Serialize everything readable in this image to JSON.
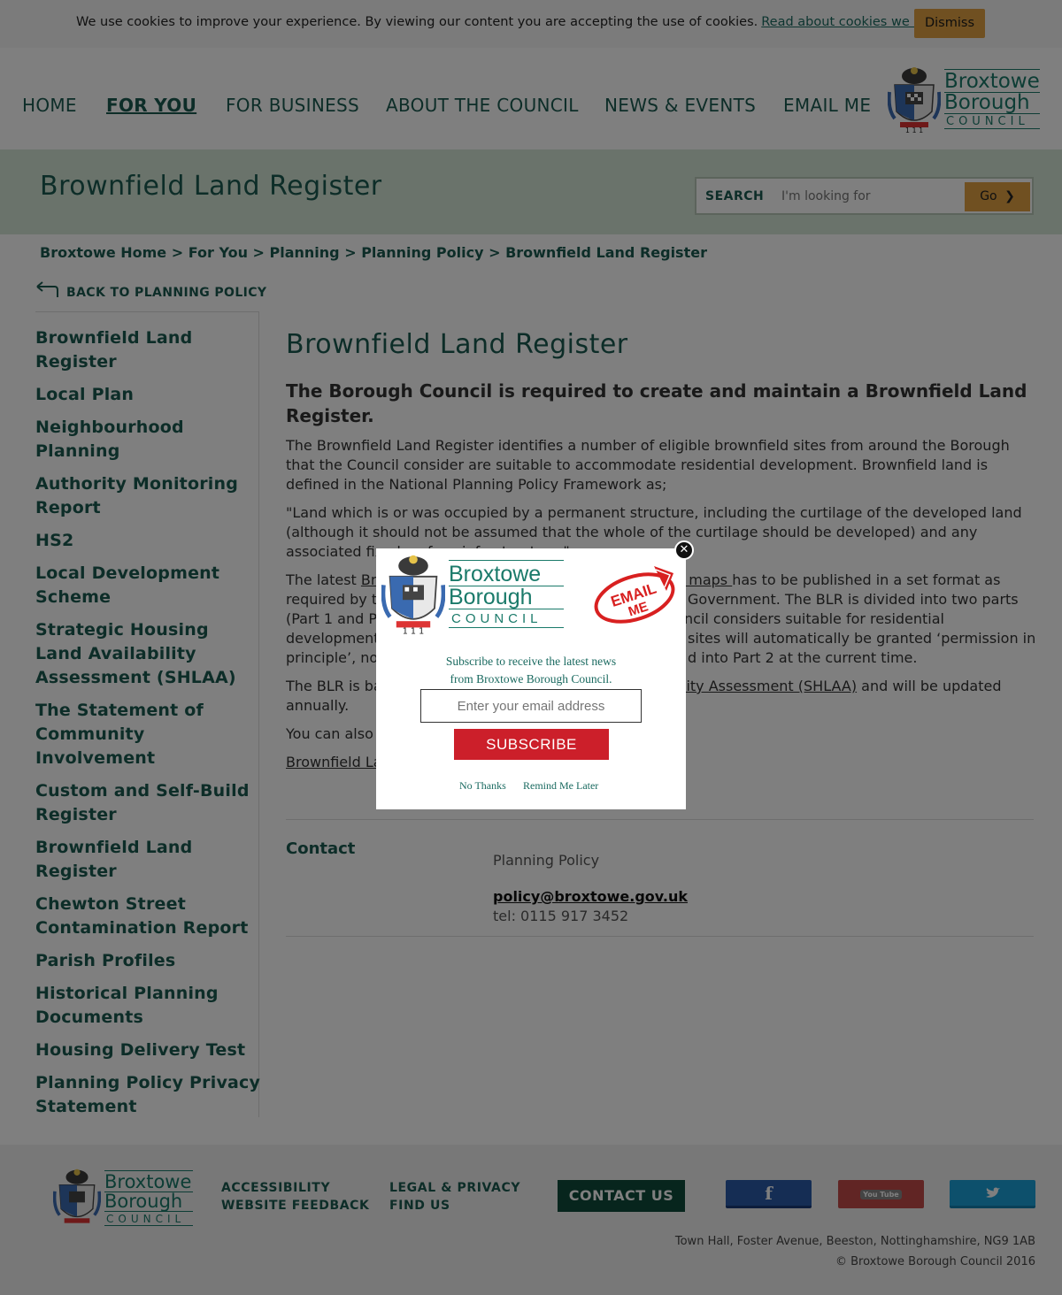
{
  "cookie": {
    "text": "We use cookies to improve your experience. By viewing our content you are accepting the use of cookies.",
    "link": "Read about cookies we use.",
    "dismiss": "Dismiss"
  },
  "nav": {
    "items": [
      "HOME",
      "FOR YOU",
      "FOR BUSINESS",
      "ABOUT THE COUNCIL",
      "NEWS & EVENTS",
      "EMAIL ME"
    ],
    "active": "FOR YOU"
  },
  "logo": {
    "line1": "Broxtowe",
    "line2": "Borough",
    "line3": "COUNCIL"
  },
  "banner": {
    "title": "Brownfield Land Register",
    "search_label": "SEARCH",
    "search_placeholder": "I'm looking for",
    "search_button": "Go"
  },
  "breadcrumb": [
    "Broxtowe Home",
    "For You",
    "Planning",
    "Planning Policy",
    "Brownfield Land Register"
  ],
  "back_label": "BACK TO PLANNING POLICY",
  "sidebar": {
    "items": [
      "Brownfield Land Register",
      "Local Plan",
      "Neighbourhood Planning",
      "Authority Monitoring Report",
      "HS2",
      "Local Development Scheme",
      "Strategic Housing Land Availability Assessment (SHLAA)",
      "The Statement of Community Involvement",
      "Custom and Self-Build Register",
      "Brownfield Land Register",
      "Chewton Street Contamination Report",
      "Parish Profiles",
      "Historical Planning Documents",
      "Housing Delivery Test",
      "Planning Policy Privacy Statement"
    ]
  },
  "main": {
    "title": "Brownfield Land Register",
    "lead": "The Borough Council is required to create and maintain a Brownfield Land Register.",
    "p1": "The Brownfield Land Register identifies a number of eligible brownfield sites from around the Borough that the Council consider are suitable to accommodate residential development. Brownfield land is defined in the National Planning Policy Framework as;",
    "p2": "\"Land which is or was occupied by a permanent structure, including the curtilage of the developed land (although it should not be assumed that the whole of the curtilage should be developed) and any associated fixed surface infrastructure.\"",
    "p3_a": "The latest ",
    "p3_link1": "Br",
    "p3_link2": "d maps ",
    "p3_b": "has to be published in a set format as",
    "p3_l2a": "required by t",
    "p3_l2b": "Government. The BLR is divided into two parts",
    "p3_l3a": "(Part 1 and P",
    "p3_l3b": "ncil considers suitable for residential",
    "p3_l4a": "development",
    "p3_l4b": "sites will automatically be granted ‘permission in",
    "p3_l5a": "principle’, no",
    "p3_l5b": "d into Part 2 at the current time.",
    "p4_a": "The BLR is ba",
    "p4_link": "lity Assessment (SHLAA)",
    "p4_b": " and will be updated",
    "p4_c": "annually.",
    "p5": "You can also",
    "p6_link": "Brownfield La"
  },
  "contact": {
    "label": "Contact",
    "name": "Planning Policy",
    "email": "policy@broxtowe.gov.uk",
    "tel": "tel: 0115 917 3452"
  },
  "footer": {
    "accessibility": "ACCESSIBILITY",
    "feedback": "WEBSITE FEEDBACK",
    "legal": "LEGAL & PRIVACY",
    "find": "FIND US",
    "contact": "CONTACT US",
    "address": "Town Hall, Foster Avenue, Beeston, Nottinghamshire, NG9 1AB",
    "copyright": "© Broxtowe Borough Council 2016",
    "social": [
      "f",
      "You Tube",
      "twitter"
    ]
  },
  "modal": {
    "text1": "Subscribe to receive the latest news",
    "text2": "from Broxtowe Borough Council.",
    "email_placeholder": "Enter your email address",
    "subscribe": "SUBSCRIBE",
    "no_thanks": "No Thanks",
    "remind": "Remind Me Later",
    "badge_line1": "EMAIL",
    "badge_line2": "ME"
  },
  "colors": {
    "brand_green": "#1a5a50",
    "accent_orange": "#e0a042",
    "banner_bg": "#d5e6d6",
    "subscribe_red": "#cc1f2a"
  }
}
